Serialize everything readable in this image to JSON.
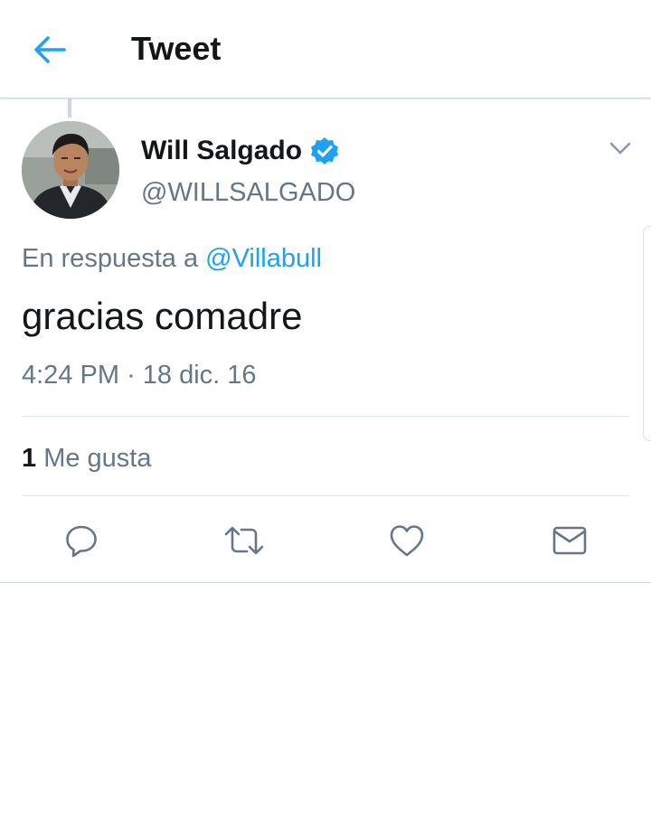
{
  "header": {
    "title": "Tweet",
    "back_icon": "back-arrow-icon",
    "accent_color": "#1da1f2"
  },
  "author": {
    "display_name": "Will Salgado",
    "handle": "@WILLSALGADO",
    "verified": true,
    "verified_icon": "verified-badge-icon"
  },
  "tweet": {
    "reply_prefix": "En respuesta a",
    "reply_handle": "@Villabull",
    "text": "gracias comadre",
    "time": "4:24 PM",
    "separator": "·",
    "date": "18 dic. 16"
  },
  "stats": {
    "likes_count": "1",
    "likes_label": "Me gusta"
  },
  "actions": [
    {
      "name": "reply",
      "icon": "reply-icon"
    },
    {
      "name": "retweet",
      "icon": "retweet-icon"
    },
    {
      "name": "like",
      "icon": "heart-icon"
    },
    {
      "name": "direct-message",
      "icon": "envelope-icon"
    }
  ],
  "colors": {
    "text_primary": "#14171a",
    "text_secondary": "#657786",
    "link": "#1da1f2",
    "divider": "#e1e8ed"
  }
}
